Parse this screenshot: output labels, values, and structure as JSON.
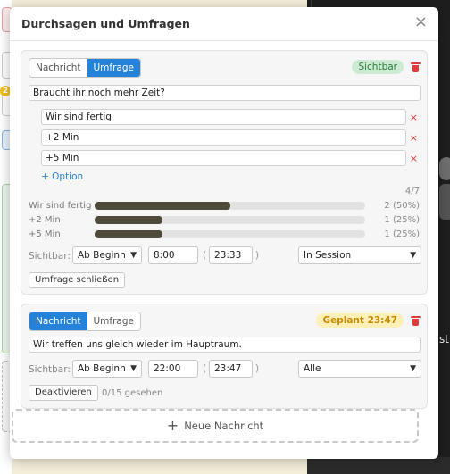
{
  "modal": {
    "title": "Durchsagen und Umfragen",
    "close_glyph": "×"
  },
  "background": {
    "badge_count": "2",
    "right_text": "st"
  },
  "poll_card": {
    "tabs": [
      {
        "label": "Nachricht",
        "active": false
      },
      {
        "label": "Umfrage",
        "active": true
      }
    ],
    "status_badge": "Sichtbar",
    "status_color": "#cdebd2",
    "question": "Braucht ihr noch mehr Zeit?",
    "options": [
      {
        "value": "Wir sind fertig"
      },
      {
        "value": "+2 Min"
      },
      {
        "value": "+5 Min"
      }
    ],
    "delete_glyph": "×",
    "add_option": "+ Option",
    "vote_count": "4/7",
    "results": [
      {
        "label": "Wir sind fertig",
        "value": 2,
        "fraction": 0.5,
        "display": "2 (50%)"
      },
      {
        "label": "+2 Min",
        "value": 1,
        "fraction": 0.25,
        "display": "1 (25%)"
      },
      {
        "label": "+5 Min",
        "value": 1,
        "fraction": 0.25,
        "display": "1 (25%)"
      }
    ],
    "visibility": {
      "label": "Sichtbar:",
      "from_select": "Ab Beginn",
      "start_time": "8:00",
      "open_paren": "(",
      "end_time": "23:33",
      "close_paren": ")",
      "scope_select": "In Session"
    },
    "close_button": "Umfrage schließen"
  },
  "message_card": {
    "tabs": [
      {
        "label": "Nachricht",
        "active": true
      },
      {
        "label": "Umfrage",
        "active": false
      }
    ],
    "status_badge": "Geplant 23:47",
    "status_color": "#fff0b8",
    "message": "Wir treffen uns gleich wieder im Hauptraum.",
    "visibility": {
      "label": "Sichtbar:",
      "from_select": "Ab Beginn",
      "start_time": "22:00",
      "open_paren": "(",
      "end_time": "23:47",
      "close_paren": ")",
      "scope_select": "Alle"
    },
    "deactivate_button": "Deaktivieren",
    "seen_text": "0/15 gesehen"
  },
  "new_message": {
    "plus": "+",
    "label": "Neue Nachricht"
  },
  "colors": {
    "accent": "#2483d9",
    "danger": "#e03b3b",
    "bar_fill": "#4f4a3a"
  }
}
